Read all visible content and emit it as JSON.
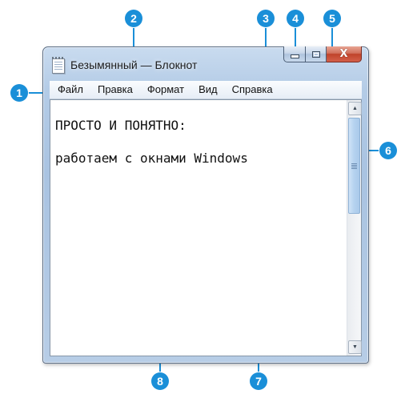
{
  "window": {
    "title": "Безымянный — Блокнот",
    "caption_buttons": {
      "minimize_icon": "minimize-icon",
      "maximize_icon": "maximize-icon",
      "close_icon": "close-icon",
      "close_glyph": "X"
    }
  },
  "menu": {
    "items": [
      "Файл",
      "Правка",
      "Формат",
      "Вид",
      "Справка"
    ]
  },
  "editor": {
    "lines": [
      "ПРОСТО И ПОНЯТНО:",
      "работаем с окнами Windows"
    ]
  },
  "scrollbar": {
    "up_arrow": "▲",
    "down_arrow": "▼"
  },
  "callouts": {
    "menu_bar": "1",
    "title_bar": "2",
    "minimize": "3",
    "maximize": "4",
    "close": "5",
    "scrollbar": "6",
    "border": "7",
    "work_area": "8"
  },
  "colors": {
    "callout": "#1a8fd8",
    "close_button": "#c0432a"
  }
}
